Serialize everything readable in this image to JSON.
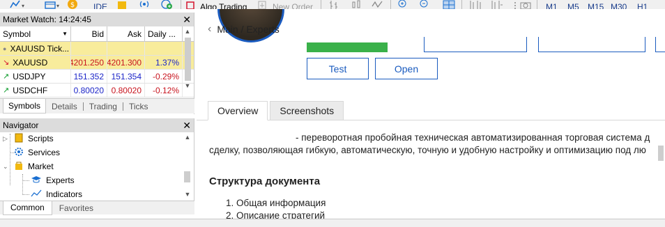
{
  "toolbar": {
    "ide_label": "IDE",
    "algo_label": "Algo Trading",
    "new_order_label": "New Order",
    "timeframes": [
      "M1",
      "M5",
      "M15",
      "M30",
      "H1"
    ]
  },
  "market_watch": {
    "title": "Market Watch: 14:24:45",
    "columns": {
      "symbol": "Symbol",
      "bid": "Bid",
      "ask": "Ask",
      "daily": "Daily ..."
    },
    "rows": [
      {
        "symbol": "XAUUSD Tick...",
        "bid": "",
        "ask": "",
        "daily": "",
        "icon": "dot"
      },
      {
        "symbol": "XAUUSD",
        "bid": "4201.250",
        "ask": "4201.300",
        "daily": "1.37%",
        "icon": "arrow-down",
        "daily_color": "blue"
      },
      {
        "symbol": "USDJPY",
        "bid": "151.352",
        "ask": "151.354",
        "daily": "-0.29%",
        "icon": "arrow-up",
        "daily_color": "red"
      },
      {
        "symbol": "USDCHF",
        "bid": "0.80020",
        "ask": "0.80020",
        "daily": "-0.12%",
        "icon": "arrow-up",
        "daily_color": "red"
      }
    ],
    "tabs": [
      "Symbols",
      "Details",
      "Trading",
      "Ticks"
    ]
  },
  "navigator": {
    "title": "Navigator",
    "items": [
      "Scripts",
      "Services",
      "Market",
      "Experts",
      "Indicators"
    ],
    "tabs": [
      "Common",
      "Favorites"
    ]
  },
  "main": {
    "breadcrumb": "Main / Experts",
    "buttons": {
      "test": "Test",
      "open": "Open"
    },
    "tabs": [
      "Overview",
      "Screenshots"
    ],
    "description_line1": "- переворотная пробойная техническая автоматизированная торговая система д",
    "description_line2": "сделку, позволяющая гибкую, автоматическую, точную и удобную настройку и оптимизацию под лю",
    "doc_title": "Структура документа",
    "toc": [
      "1. Общая информация",
      "2. Описание стратегий"
    ]
  },
  "colors": {
    "accent": "#1a5bbf",
    "green": "#3ab14a",
    "highlight_row": "#f8ec9c",
    "up": "#0b9a2a",
    "down": "#d4132c"
  }
}
